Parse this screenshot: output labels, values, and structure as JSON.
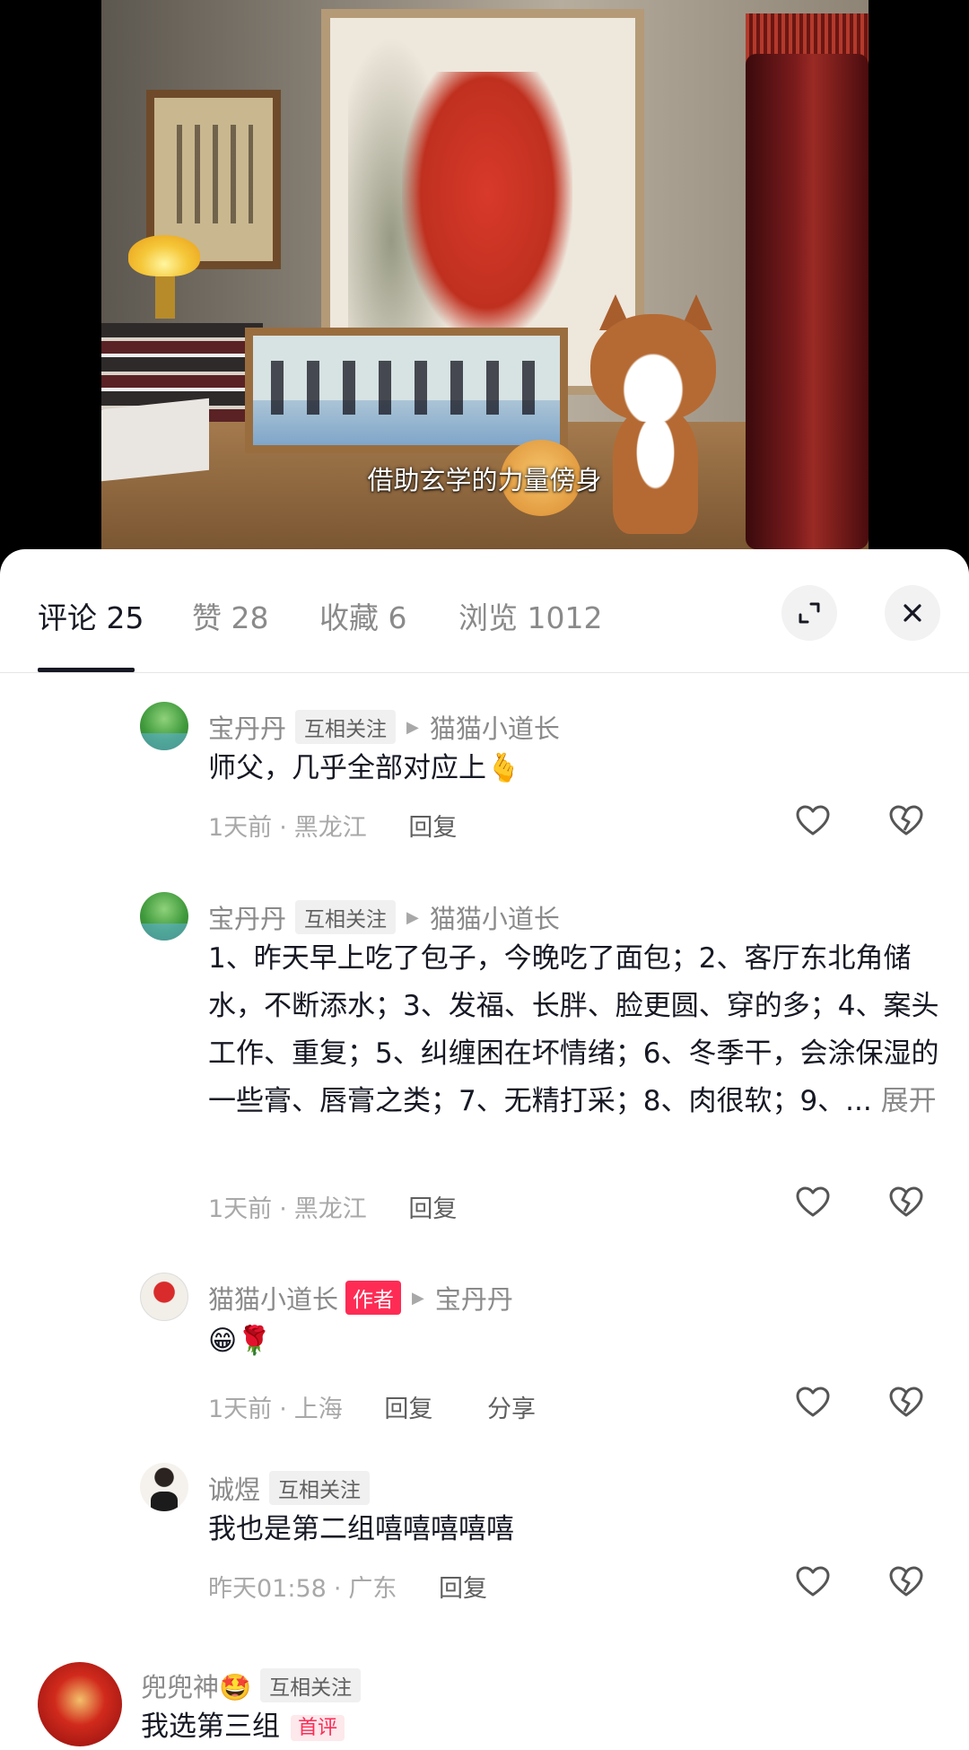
{
  "video": {
    "subtitle": "借助玄学的力量傍身"
  },
  "tabs": [
    {
      "label": "评论 25"
    },
    {
      "label": "赞 28"
    },
    {
      "label": "收藏 6"
    },
    {
      "label": "浏览 1012"
    }
  ],
  "header_icons": {
    "expand": "expand-icon",
    "close": "close-icon"
  },
  "comments": [
    {
      "user": "宝丹丹",
      "tag": "互相关注",
      "reply_to": "猫猫小道长",
      "text": "师父，几乎全部对应上🫰",
      "time": "1天前",
      "location": "黑龙江",
      "reply": "回复"
    },
    {
      "user": "宝丹丹",
      "tag": "互相关注",
      "reply_to": "猫猫小道长",
      "text": "1、昨天早上吃了包子，今晚吃了面包；2、客厅东北角储水，不断添水；3、发福、长胖、脸更圆、穿的多；4、案头工作、重复；5、纠缠困在坏情绪；6、冬季干，会涂保湿的一些膏、唇膏之类；7、无精打采；8、肉很软；9、...",
      "expand": "展开",
      "time": "1天前",
      "location": "黑龙江",
      "reply": "回复"
    },
    {
      "user": "猫猫小道长",
      "author_tag": "作者",
      "reply_to": "宝丹丹",
      "text": "😁🌹",
      "time": "1天前",
      "location": "上海",
      "reply": "回复",
      "share": "分享"
    },
    {
      "user": "诚煜",
      "tag": "互相关注",
      "text": "我也是第二组嘻嘻嘻嘻嘻",
      "time": "昨天01:58",
      "location": "广东",
      "reply": "回复"
    },
    {
      "user": "兜兜神🤩",
      "tag": "互相关注",
      "text": "我选第三组",
      "first_tag": "首评"
    }
  ],
  "colors": {
    "accent": "#fe2c55",
    "text": "#161823",
    "muted": "#8a8a8a"
  }
}
